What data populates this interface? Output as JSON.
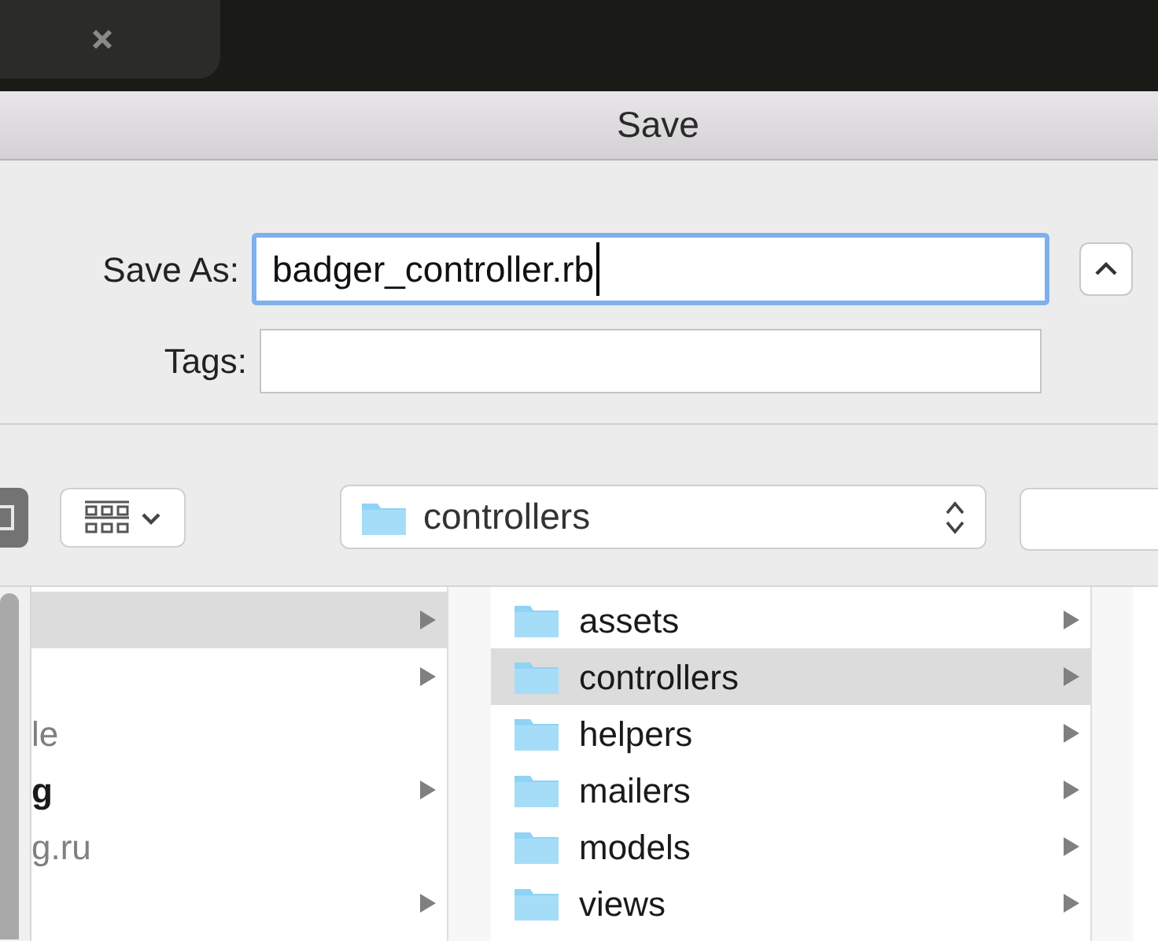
{
  "window": {
    "title": "Save"
  },
  "form": {
    "save_as": {
      "label": "Save As:",
      "value": "badger_controller.rb",
      "focused": true
    },
    "tags": {
      "label": "Tags:"
    }
  },
  "toolbar": {
    "location": "controllers"
  },
  "columns": [
    {
      "items": [
        {
          "selected": true,
          "has_children": true
        },
        {
          "selected": false,
          "has_children": true
        },
        {
          "label": "le",
          "selected": false,
          "has_children": false,
          "dimmed": true
        },
        {
          "label": "g",
          "selected": false,
          "has_children": true,
          "dimmed": false
        },
        {
          "label": "g.ru",
          "selected": false,
          "has_children": false,
          "dimmed": true
        },
        {
          "selected": false,
          "has_children": true
        }
      ]
    },
    {
      "items": [
        {
          "label": "assets",
          "selected": false,
          "has_children": true
        },
        {
          "label": "controllers",
          "selected": true,
          "has_children": true
        },
        {
          "label": "helpers",
          "selected": false,
          "has_children": true
        },
        {
          "label": "mailers",
          "selected": false,
          "has_children": true
        },
        {
          "label": "models",
          "selected": false,
          "has_children": true
        },
        {
          "label": "views",
          "selected": false,
          "has_children": true
        }
      ]
    }
  ]
}
